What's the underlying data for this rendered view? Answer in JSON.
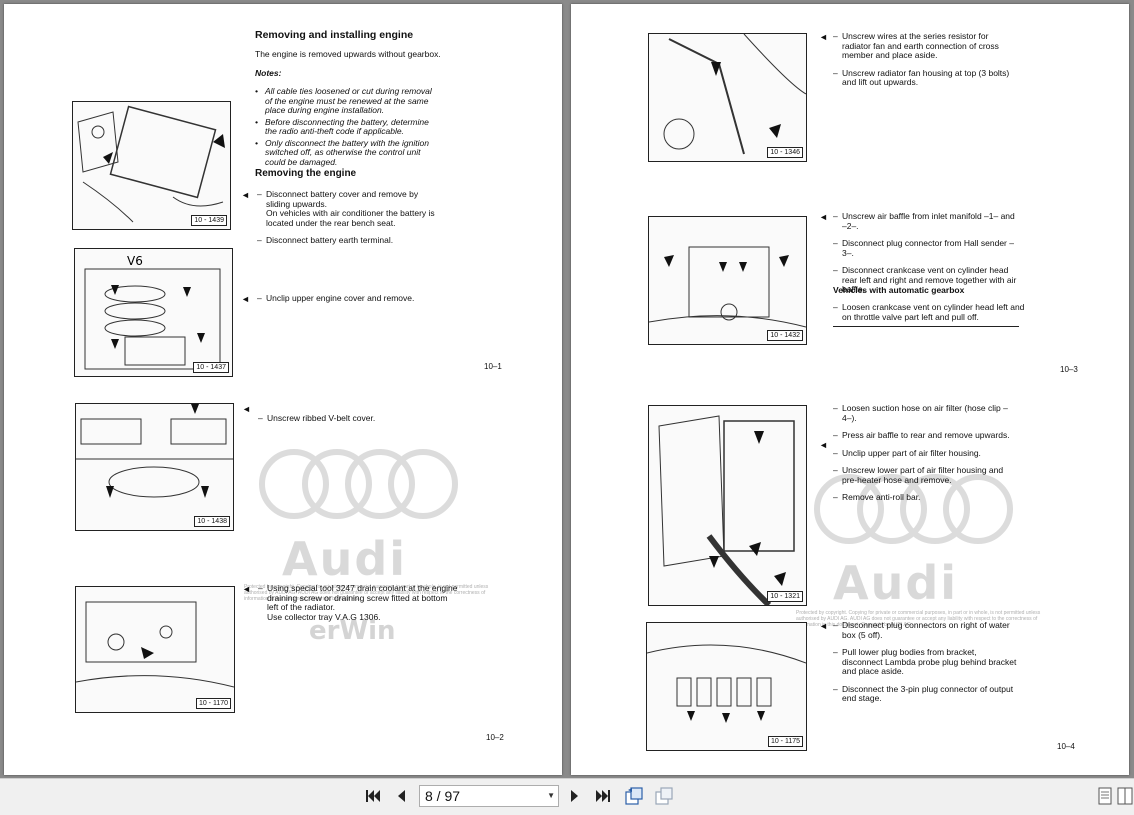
{
  "left_page": {
    "title": "Removing and installing engine",
    "intro": "The engine is removed upwards without gearbox.",
    "notes_label": "Notes:",
    "notes": [
      "All cable ties loosened or cut during removal of the engine must be renewed at the same place during engine installation.",
      "Before disconnecting the battery, determine the radio anti-theft code if applicable.",
      "Only disconnect the battery with the ignition switched off, as otherwise the control unit could be damaged."
    ],
    "section_title": "Removing the engine",
    "steps_a": [
      "Disconnect battery cover and remove by sliding upwards.",
      "On vehicles with air conditioner the battery is located under the rear bench seat.",
      "Disconnect battery earth terminal."
    ],
    "step_b": "Unclip upper engine cover and remove.",
    "page_num_1": "10–1",
    "step_c": "Unscrew ribbed V-belt cover.",
    "step_d_1": "Using special tool 3247 drain coolant at the engine draining screw or draining screw fitted at bottom left of the radiator.",
    "step_d_2": "Use collector tray V.A.G 1306.",
    "page_num_2": "10–2",
    "fig_labels": [
      "10 - 1439",
      "10 - 1437",
      "10 - 1438",
      "10 - 1170"
    ],
    "arrow_glyph": "◄"
  },
  "right_page": {
    "steps_a": [
      "Unscrew wires at the series resistor for radiator fan and earth connection of cross member and place aside.",
      "Unscrew radiator fan housing at top (3 bolts) and lift out upwards."
    ],
    "steps_b": [
      "Unscrew air baffle from inlet manifold –1– and –2–.",
      "Disconnect plug connector from Hall sender –3–.",
      "Disconnect crankcase vent on cylinder head rear left and right and remove together with air baffle."
    ],
    "subheading": "Vehicles with automatic gearbox",
    "step_auto": "Loosen crankcase vent on cylinder head left and on throttle valve part left and pull off.",
    "page_num_3": "10–3",
    "steps_c": [
      "Loosen suction hose on air filter (hose clip –4–).",
      "Press air baffle to rear and remove upwards.",
      "Unclip upper part of air filter housing.",
      "Unscrew lower part of air filter housing and pre-heater hose and remove.",
      "Remove anti-roll bar."
    ],
    "steps_d": [
      "Disconnect plug connectors on right of water box (5 off).",
      "Pull lower plug bodies from bracket, disconnect Lambda probe plug behind bracket and place aside.",
      "Disconnect the 3-pin plug connector of output end stage."
    ],
    "page_num_4": "10–4",
    "fig_labels": [
      "10 - 1346",
      "10 - 1432",
      "10 - 1321",
      "10 - 1175"
    ]
  },
  "watermark": {
    "brand": "Audi",
    "sub": "erWin",
    "copyright": "Protected by copyright. Copying for private or commercial purposes, in part or in whole, is not permitted unless authorised by AUDI AG. AUDI AG does not guarantee or accept any liability with respect to the correctness of information in this document. Copyright by AUDI AG."
  },
  "toolbar": {
    "page_indicator": "8 / 97",
    "icons": [
      "first-page-icon",
      "prev-page-icon",
      "next-page-icon",
      "last-page-icon",
      "rotate-page-icon",
      "fit-page-icon",
      "single-page-view-icon",
      "two-page-view-icon"
    ]
  }
}
